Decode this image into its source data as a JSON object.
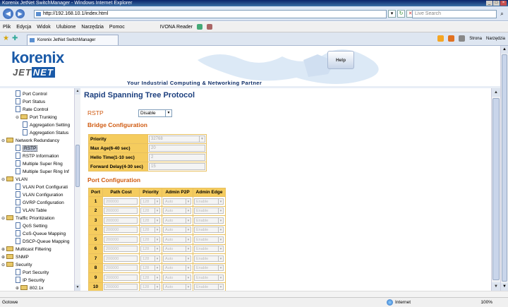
{
  "window": {
    "title": "Korenix JetNet SwitchManager - Windows Internet Explorer"
  },
  "browser": {
    "url": "http://192.168.10.1/index.html",
    "search_placeholder": "Live Search",
    "tab_title": "Korenix JetNet SwitchManager",
    "menu": [
      "Plik",
      "Edycja",
      "Widok",
      "Ulubione",
      "Narzędzia",
      "Pomoc"
    ],
    "ivona_label": "IVONA Reader",
    "tools": {
      "page_label": "Strona",
      "tools_label": "Narzędzia"
    },
    "status": {
      "left": "Gotowe",
      "zone": "Internet",
      "zoom": "100%"
    }
  },
  "header": {
    "logo_word": "korenix",
    "logo_sub_a": "JET",
    "logo_sub_b": "NET",
    "tagline": "Your Industrial Computing & Networking Partner",
    "help_label": "Help"
  },
  "nav": {
    "items": [
      {
        "label": "Port Control",
        "level": 2,
        "type": "doc"
      },
      {
        "label": "Port Status",
        "level": 2,
        "type": "doc"
      },
      {
        "label": "Rate Control",
        "level": 2,
        "type": "doc"
      },
      {
        "label": "Port Trunking",
        "level": 2,
        "type": "folder",
        "open": true
      },
      {
        "label": "Aggregation Setting",
        "level": 3,
        "type": "doc"
      },
      {
        "label": "Aggregation Status",
        "level": 3,
        "type": "doc"
      },
      {
        "label": "Network Redundancy",
        "level": 1,
        "type": "folder",
        "open": true
      },
      {
        "label": "RSTP",
        "level": 2,
        "type": "doc",
        "selected": true
      },
      {
        "label": "RSTP Information",
        "level": 2,
        "type": "doc"
      },
      {
        "label": "Multiple Super Ring",
        "level": 2,
        "type": "doc"
      },
      {
        "label": "Multiple Super Ring Inf",
        "level": 2,
        "type": "doc"
      },
      {
        "label": "VLAN",
        "level": 1,
        "type": "folder",
        "open": true
      },
      {
        "label": "VLAN Port Configurati",
        "level": 2,
        "type": "doc"
      },
      {
        "label": "VLAN Configuration",
        "level": 2,
        "type": "doc"
      },
      {
        "label": "GVRP Configuration",
        "level": 2,
        "type": "doc"
      },
      {
        "label": "VLAN Table",
        "level": 2,
        "type": "doc"
      },
      {
        "label": "Traffic Prioritization",
        "level": 1,
        "type": "folder",
        "open": true
      },
      {
        "label": "QoS Setting",
        "level": 2,
        "type": "doc"
      },
      {
        "label": "CoS-Queue Mapping",
        "level": 2,
        "type": "doc"
      },
      {
        "label": "DSCP-Queue Mapping",
        "level": 2,
        "type": "doc"
      },
      {
        "label": "Multicast Filtering",
        "level": 1,
        "type": "folder",
        "open": false
      },
      {
        "label": "SNMP",
        "level": 1,
        "type": "folder",
        "open": false
      },
      {
        "label": "Security",
        "level": 1,
        "type": "folder",
        "open": true
      },
      {
        "label": "Port Security",
        "level": 2,
        "type": "doc"
      },
      {
        "label": "IP Security",
        "level": 2,
        "type": "doc"
      },
      {
        "label": "802.1x",
        "level": 2,
        "type": "folder",
        "open": false
      }
    ]
  },
  "main": {
    "page_title": "Rapid Spanning Tree Protocol",
    "rstp_label": "RSTP",
    "rstp_value": "Disable",
    "bridge_title": "Bridge Configuration",
    "bridge_rows": [
      {
        "key": "Priority",
        "value": "32768",
        "kind": "select"
      },
      {
        "key": "Max Age(6-40 sec)",
        "value": "20",
        "kind": "input"
      },
      {
        "key": "Hello Time(1-10 sec)",
        "value": "2",
        "kind": "input"
      },
      {
        "key": "Forward Delay(4-30 sec)",
        "value": "15",
        "kind": "input"
      }
    ],
    "port_title": "Port Configuration",
    "port_headers": [
      "Port",
      "Path Cost",
      "Priority",
      "Admin P2P",
      "Admin Edge"
    ],
    "port_rows": [
      {
        "port": "1",
        "path_cost": "200000",
        "priority": "128",
        "p2p": "Auto",
        "edge": "Enable"
      },
      {
        "port": "2",
        "path_cost": "200000",
        "priority": "128",
        "p2p": "Auto",
        "edge": "Enable"
      },
      {
        "port": "3",
        "path_cost": "200000",
        "priority": "128",
        "p2p": "Auto",
        "edge": "Enable"
      },
      {
        "port": "4",
        "path_cost": "200000",
        "priority": "128",
        "p2p": "Auto",
        "edge": "Enable"
      },
      {
        "port": "5",
        "path_cost": "200000",
        "priority": "128",
        "p2p": "Auto",
        "edge": "Enable"
      },
      {
        "port": "6",
        "path_cost": "200000",
        "priority": "128",
        "p2p": "Auto",
        "edge": "Enable"
      },
      {
        "port": "7",
        "path_cost": "200000",
        "priority": "128",
        "p2p": "Auto",
        "edge": "Enable"
      },
      {
        "port": "8",
        "path_cost": "200000",
        "priority": "128",
        "p2p": "Auto",
        "edge": "Enable"
      },
      {
        "port": "9",
        "path_cost": "200000",
        "priority": "128",
        "p2p": "Auto",
        "edge": "Enable"
      },
      {
        "port": "10",
        "path_cost": "200000",
        "priority": "128",
        "p2p": "Auto",
        "edge": "Enable"
      }
    ]
  }
}
